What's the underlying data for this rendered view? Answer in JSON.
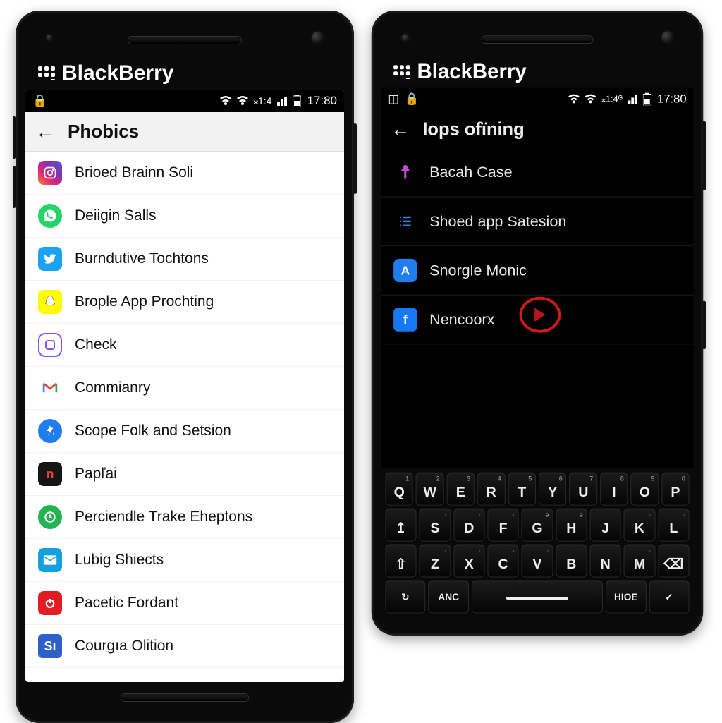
{
  "phone1": {
    "brand": "BlackBerry",
    "status": {
      "time": "17:80",
      "net": "𝄪1:4"
    },
    "title": "Phobics",
    "items": [
      {
        "name": "instagram-icon",
        "label": "Brioed Brainn Soli"
      },
      {
        "name": "whatsapp-icon",
        "label": "Deiigin Salls"
      },
      {
        "name": "twitter-icon",
        "label": "Burndutive Tochtons"
      },
      {
        "name": "snapchat-icon",
        "label": "Brople App Prochting"
      },
      {
        "name": "square-icon",
        "label": "Check"
      },
      {
        "name": "gmail-icon",
        "label": "Commianry"
      },
      {
        "name": "appstore-icon",
        "label": "Scope Folk and Setsion"
      },
      {
        "name": "letter-n-icon",
        "label": "Papľai"
      },
      {
        "name": "clock-icon",
        "label": "Perciendle Trake Eheptons"
      },
      {
        "name": "mail-icon",
        "label": "Lubig Shiects"
      },
      {
        "name": "power-icon",
        "label": "Pacetic Fordant"
      },
      {
        "name": "letter-s-icon",
        "label": "Courgıa Olition"
      }
    ]
  },
  "phone2": {
    "brand": "BlackBerry",
    "status": {
      "time": "17:80",
      "net": "𝄪1:4ᴳ"
    },
    "title": "Iops ofïning",
    "items": [
      {
        "name": "anchor-icon",
        "label": "Bacah Case"
      },
      {
        "name": "list-icon",
        "label": "Shoed app Satesion"
      },
      {
        "name": "letter-a-icon",
        "label": "Snorgle Monic"
      },
      {
        "name": "facebook-icon",
        "label": "Nencoorx"
      }
    ],
    "keyboard": {
      "r1": [
        "Q",
        "W",
        "E",
        "R",
        "T",
        "Y",
        "U",
        "I",
        "O",
        "P"
      ],
      "r2": [
        "↥",
        "S",
        "D",
        "F",
        "G",
        "H",
        "J",
        "K",
        "L"
      ],
      "r3": [
        "⇧",
        "Z",
        "X",
        "C",
        "V",
        "B",
        "N",
        "M",
        "⌫"
      ],
      "r4": [
        "↻",
        "ANC",
        "—",
        "HIOE",
        "✓"
      ]
    }
  }
}
